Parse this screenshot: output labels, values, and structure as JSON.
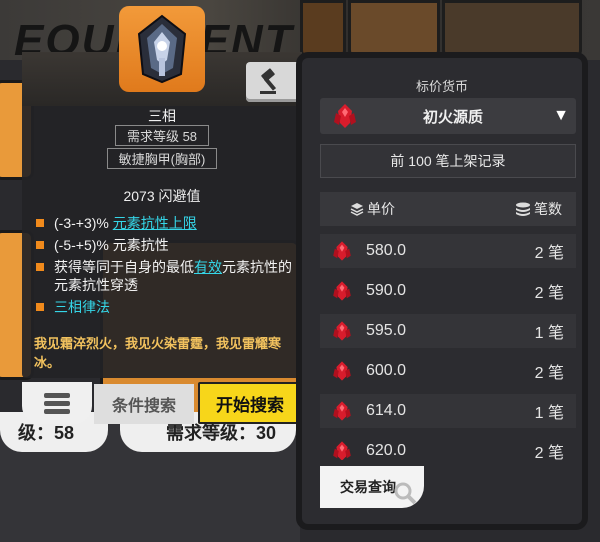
{
  "background": {
    "title": "EQUIPMENT",
    "left_pill_text": "级：58",
    "mid_pill_text": "需求等级：30"
  },
  "item": {
    "name": "三相",
    "level_req": "需求等级 58",
    "slot": "敏捷胸甲(胸部)",
    "dodge": "2073 闪避值",
    "stats": [
      {
        "prefix": "(-3-+3)% ",
        "link": "元素抗性上限",
        "suffix": ""
      },
      {
        "prefix": "(-5-+5)% 元素抗性",
        "link": "",
        "suffix": ""
      },
      {
        "prefix": "获得等同于自身的最低",
        "link": "有效",
        "suffix": "元素抗性的元素抗性穿透"
      }
    ],
    "set_label": "三相律法",
    "flavor": "我见霜淬烈火，我见火染雷霆，我见雷耀寒冰。"
  },
  "buttons": {
    "condition_search": "条件搜索",
    "start_search": "开始搜索",
    "trade_query": "交易查询"
  },
  "trade": {
    "currency_label": "标价货币",
    "currency_selected": "初火源质",
    "record_label": "前 100 笔上架记录",
    "col_price": "单价",
    "col_count": "笔数",
    "rows": [
      {
        "price": "580.0",
        "count": "2 笔"
      },
      {
        "price": "590.0",
        "count": "2 笔"
      },
      {
        "price": "595.0",
        "count": "1 笔"
      },
      {
        "price": "600.0",
        "count": "2 笔"
      },
      {
        "price": "614.0",
        "count": "1 笔"
      },
      {
        "price": "620.0",
        "count": "2 笔"
      }
    ]
  },
  "colors": {
    "accent_orange": "#f08a1c",
    "link_cyan": "#35d6e8",
    "flavor_gold": "#f2c25e",
    "start_yellow": "#f7d61a"
  }
}
